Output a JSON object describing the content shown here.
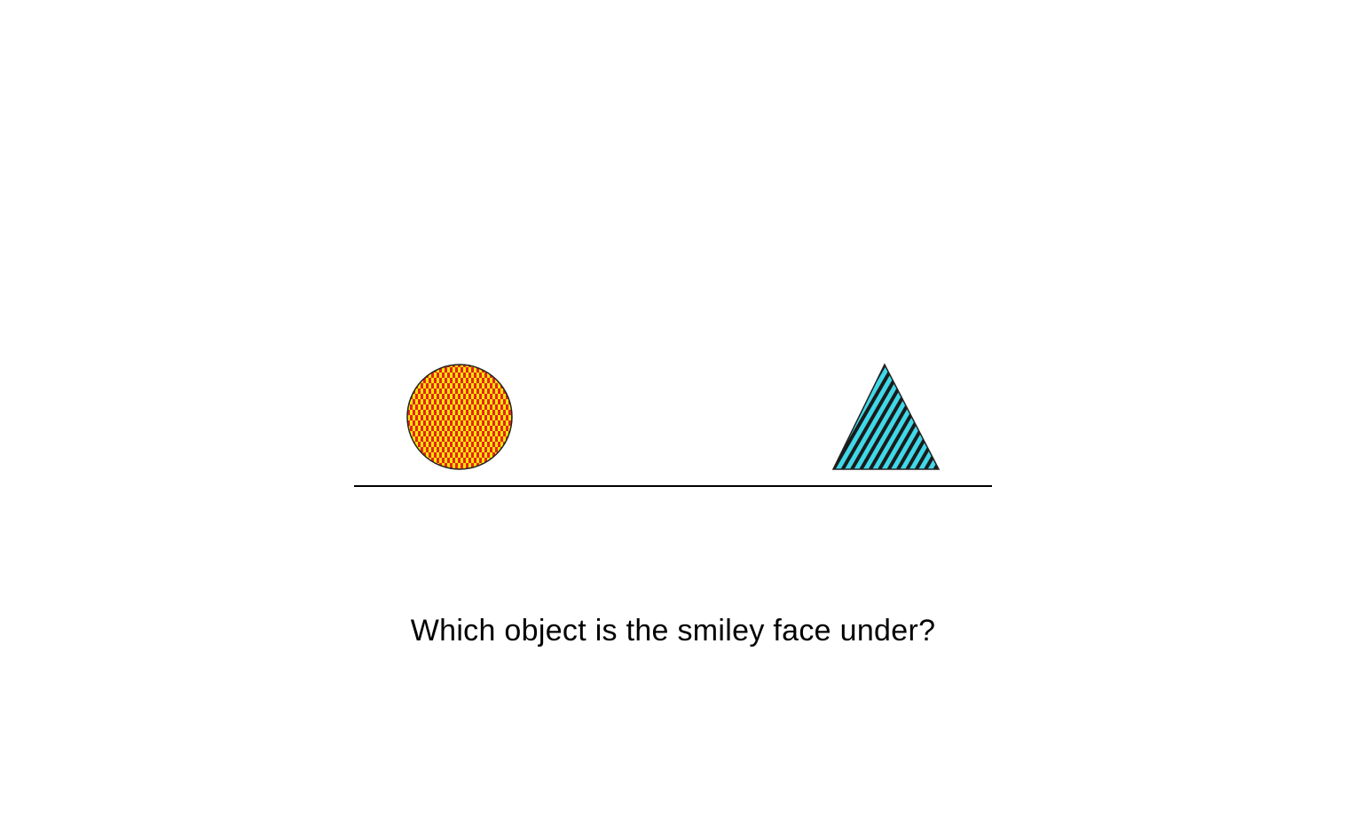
{
  "question": "Which object is the smiley face under?",
  "objects": [
    {
      "name": "circle",
      "pattern": "checkerboard",
      "colors": [
        "#f5e600",
        "#e8231f"
      ]
    },
    {
      "name": "triangle",
      "pattern": "diagonal-stripes",
      "colors": [
        "#40d8e8",
        "#1a1a1a"
      ]
    }
  ],
  "colors": {
    "ground_line": "#000000",
    "outline": "#222222"
  }
}
